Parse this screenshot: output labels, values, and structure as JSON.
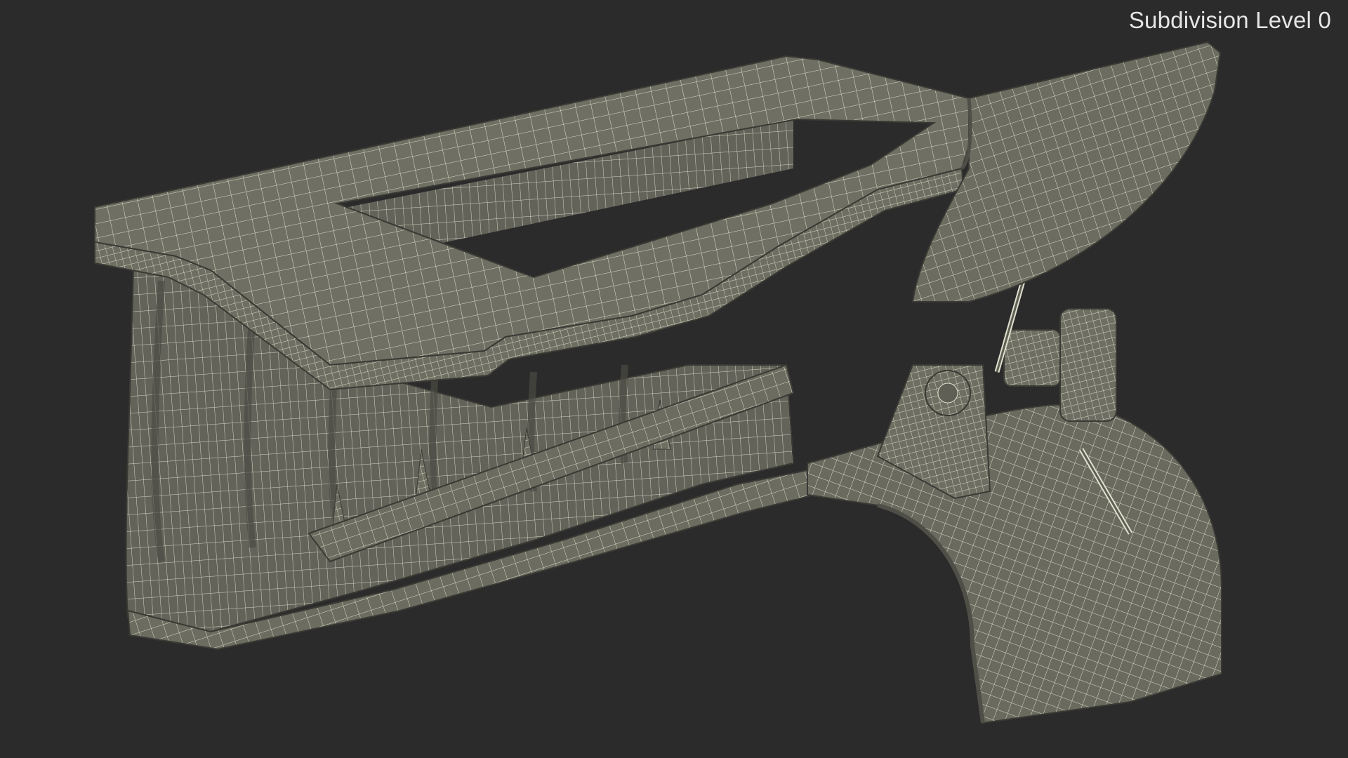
{
  "viewport": {
    "subdivision_label": "Subdivision Level 0",
    "background_color": "#2b2b2b"
  },
  "model": {
    "surface_color": "#6f6f63",
    "shadow_color": "#595950",
    "wire_color": "#dcdccb"
  }
}
